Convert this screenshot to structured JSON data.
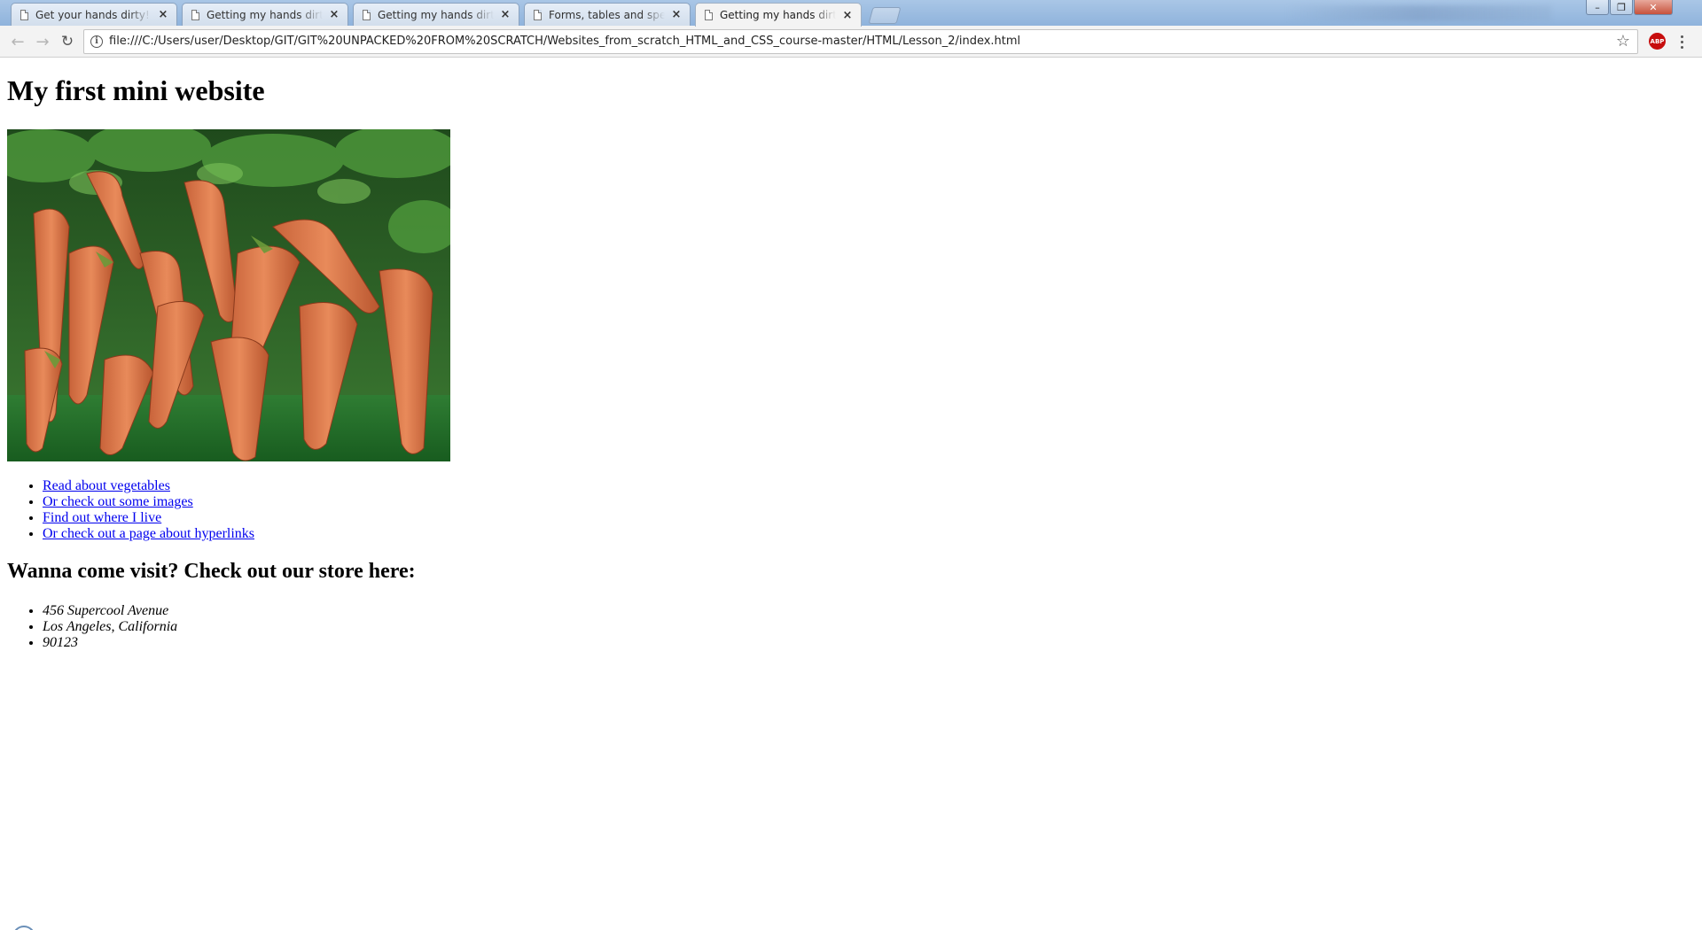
{
  "browser": {
    "tabs": [
      {
        "title": "Get your hands dirty!",
        "active": false
      },
      {
        "title": "Getting my hands dirty w",
        "active": false
      },
      {
        "title": "Getting my hands dirty!",
        "active": false
      },
      {
        "title": "Forms, tables and special",
        "active": false
      },
      {
        "title": "Getting my hands dirty w",
        "active": true
      }
    ],
    "tab_close_glyph": "×",
    "address_bar": {
      "url": "file:///C:/Users/user/Desktop/GIT/GIT%20UNPACKED%20FROM%20SCRATCH/Websites_from_scratch_HTML_and_CSS_course-master/HTML/Lesson_2/index.html",
      "info_glyph": "i"
    },
    "nav": {
      "back_glyph": "←",
      "forward_glyph": "→",
      "reload_glyph": "↻"
    },
    "bookmark_glyph": "☆",
    "extension_badge": "ABP",
    "window_controls": {
      "minimize_glyph": "–",
      "maximize_glyph": "❐",
      "close_glyph": "✕"
    }
  },
  "page": {
    "heading": "My first mini website",
    "image": {
      "subject": "carrots"
    },
    "links": [
      "Read about vegetables",
      "Or check out some images",
      "Find out where I live",
      "Or check out a page about hyperlinks"
    ],
    "visit_heading": "Wanna come visit? Check out our store here:",
    "address_lines": [
      "456 Supercool Avenue",
      "Los Angeles, California",
      "90123"
    ]
  },
  "icons": {
    "tab_icon": "page-icon",
    "info": "info-icon",
    "bookmark": "star-icon",
    "extension": "adblock-icon",
    "menu": "kebab-menu-icon"
  }
}
